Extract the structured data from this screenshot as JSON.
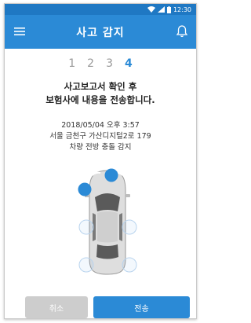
{
  "status_bar": {
    "time": "12:30"
  },
  "app_bar": {
    "title": "사고 감지"
  },
  "steps": [
    "1",
    "2",
    "3",
    "4"
  ],
  "headline": {
    "line1": "사고보고서 확인 후",
    "line2": "보험사에 내용을 전송합니다."
  },
  "incident": {
    "datetime": "2018/05/04 오후 3:57",
    "address": "서울 금천구 가산디지털2로 179",
    "description": "차량 전방 충돌 감지"
  },
  "impact_sensors": {
    "front_left": "active",
    "front_right": "active",
    "left_middle": "inactive",
    "right_middle": "inactive",
    "rear_left": "inactive",
    "rear_right": "inactive"
  },
  "buttons": {
    "cancel": "취소",
    "send": "전송"
  },
  "colors": {
    "primary": "#2b8ad6",
    "status_bar": "#1f78c3",
    "sensor_active": "#2b8ad6",
    "disabled": "#cdcdcd"
  }
}
